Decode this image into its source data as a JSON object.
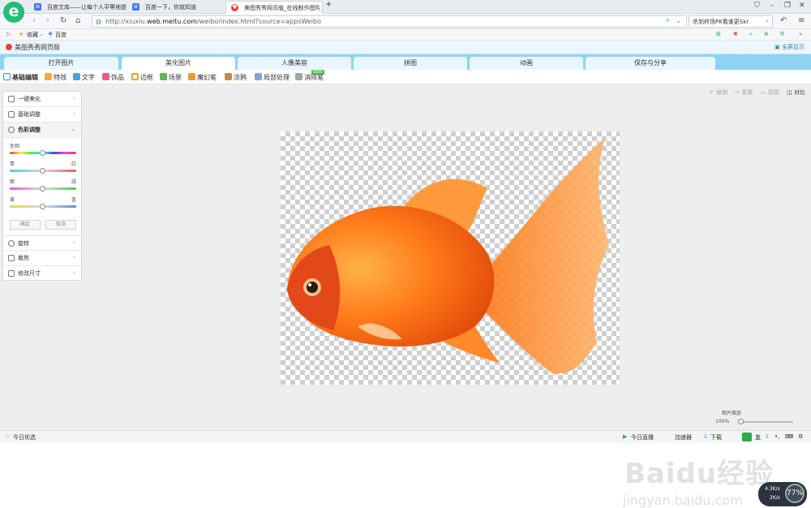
{
  "browser": {
    "tabs": [
      {
        "title": "百度文库——让每个人平等地提"
      },
      {
        "title": "百度一下，你就知道"
      },
      {
        "title": "美图秀秀网页版_在线制作图片_"
      }
    ],
    "new_tab": "+",
    "address": {
      "prefix": "http://xiuxiu.",
      "domain": "web.meitu.com",
      "path": "/weibo/index.html?source=appsWeibo"
    },
    "search_text": "杀到终场PK看谁更Skr",
    "favorites": [
      {
        "label": "收藏"
      },
      {
        "label": "百度"
      }
    ]
  },
  "app": {
    "title": "美图秀秀网页版",
    "fullscreen": "全屏显示",
    "main_tabs": [
      {
        "label": "打开图片"
      },
      {
        "label": "美化图片"
      },
      {
        "label": "人像美容"
      },
      {
        "label": "拼图"
      },
      {
        "label": "动画"
      },
      {
        "label": "保存与分享"
      }
    ],
    "active_tab": "美化图片",
    "tools": [
      {
        "label": "基础编辑",
        "color": "#3b8fd6"
      },
      {
        "label": "特效",
        "color": "#f2a93b"
      },
      {
        "label": "文字",
        "color": "#4aa3df"
      },
      {
        "label": "饰品",
        "color": "#e85c8a"
      },
      {
        "label": "边框",
        "color": "#f0a030"
      },
      {
        "label": "场景",
        "color": "#5bb85b"
      },
      {
        "label": "魔幻笔",
        "color": "#e89b2b"
      },
      {
        "label": "涂鸦",
        "color": "#c58b4a"
      },
      {
        "label": "局部处理",
        "color": "#7aa9d6"
      },
      {
        "label": "消除笔",
        "color": "#9aa"
      }
    ],
    "new_badge": "NEW",
    "canvas_actions": [
      "撤销",
      "重做",
      "原图",
      "对比"
    ],
    "panel": {
      "rows_top": [
        {
          "label": "一键美化"
        },
        {
          "label": "基础调整"
        },
        {
          "label": "色彩调整"
        }
      ],
      "sliders": [
        {
          "left": "色相",
          "right": "",
          "value": 0.5
        },
        {
          "left": "青",
          "right": "红",
          "value": 0.5
        },
        {
          "left": "紫",
          "right": "绿",
          "value": 0.5
        },
        {
          "left": "黄",
          "right": "蓝",
          "value": 0.5
        }
      ],
      "ok": "确定",
      "cancel": "取消",
      "rows_bottom": [
        {
          "label": "旋转"
        },
        {
          "label": "裁剪"
        },
        {
          "label": "修改尺寸"
        }
      ]
    },
    "zoom": {
      "label": "图片缩放",
      "value": "100%"
    }
  },
  "status": {
    "left": "今日优选",
    "items": [
      "今日直播",
      "加速器",
      "下载"
    ],
    "speed": {
      "percent": "77%",
      "up": "4.3K/s",
      "down": "2K/s"
    }
  },
  "watermark": {
    "main": "Baidu经验",
    "sub": "jingyan.baidu.com"
  }
}
